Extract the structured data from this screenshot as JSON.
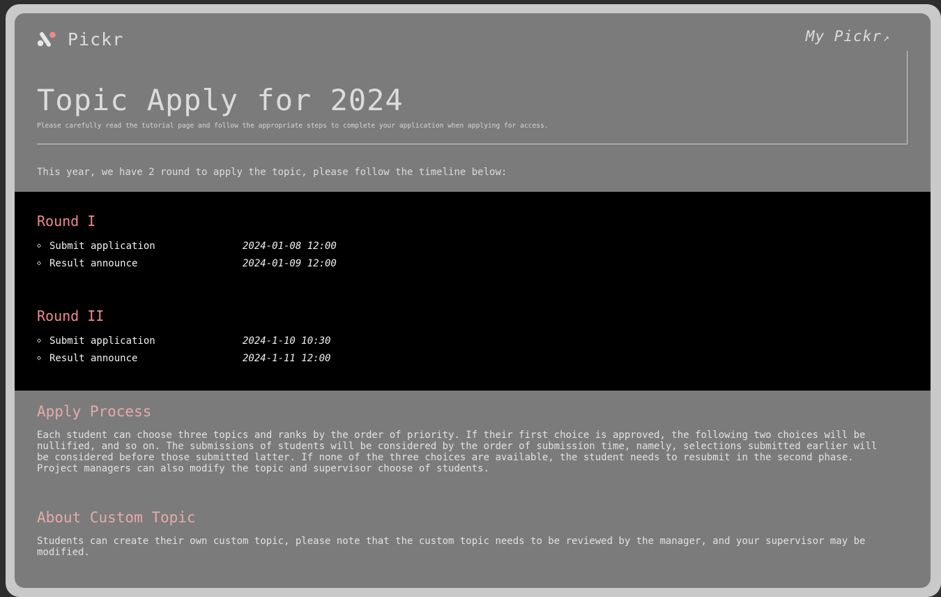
{
  "app": {
    "name": "Pickr",
    "my_link": "My Pickr",
    "my_link_arrow": "↗"
  },
  "header": {
    "title": "Topic Apply for 2024",
    "subtitle": "Please carefully read the tutorial page and follow the appropriate steps to complete your application when applying for access."
  },
  "intro": "This year, we have 2 round to apply the topic, please follow the timeline below:",
  "rounds": [
    {
      "title": "Round I",
      "items": [
        {
          "label": "Submit application",
          "date": "2024-01-08 12:00"
        },
        {
          "label": "Result announce",
          "date": "2024-01-09 12:00"
        }
      ]
    },
    {
      "title": "Round II",
      "items": [
        {
          "label": "Submit application",
          "date": "2024-1-10 10:30"
        },
        {
          "label": "Result announce",
          "date": "2024-1-11 12:00"
        }
      ]
    }
  ],
  "apply_process": {
    "title": "Apply Process",
    "body": "Each student can choose three topics and ranks by the order of priority. If their first choice is approved, the following two choices will be nullified, and so on. The submissions of students will be considered by the order of submission time, namely, selections submitted earlier will be considered before those submitted latter. If none of the three choices are available, the student needs to resubmit in the second phase. Project managers can also modify the topic and supervisor choose of students."
  },
  "custom_topic": {
    "title": "About Custom Topic",
    "body": "Students can create their own custom topic, please note that the custom topic needs to be reviewed by the manager, and your supervisor may be modified."
  },
  "icons": {
    "bullet": "◇",
    "logo": "pickr-logo-icon"
  },
  "colors": {
    "background": "#7b7b7b",
    "timeline_background": "#000000",
    "round_title": "#f08a8a",
    "section_title": "#e6aaaa",
    "logo_accent": "#f08a8a"
  }
}
